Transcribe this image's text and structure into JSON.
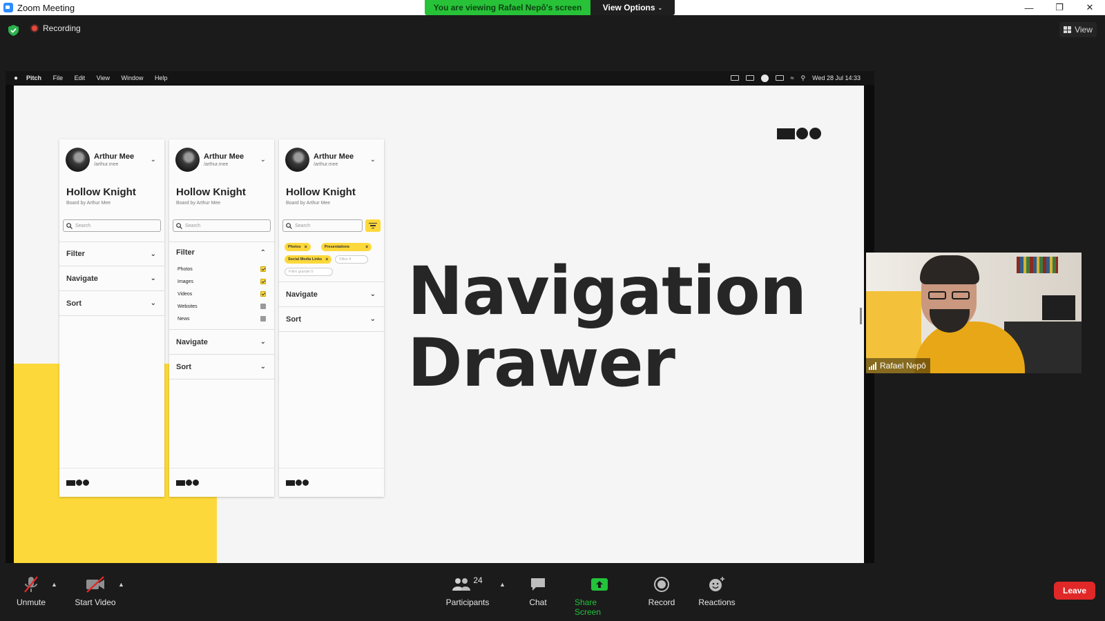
{
  "window": {
    "title": "Zoom Meeting"
  },
  "banner": {
    "viewing_text": "You are viewing Rafael Nepô's screen",
    "view_options_label": "View Options"
  },
  "meeting": {
    "recording_label": "Recording",
    "view_label": "View"
  },
  "mac_menu": {
    "items": [
      "Pitch",
      "File",
      "Edit",
      "View",
      "Window",
      "Help"
    ],
    "clock": "Wed 28 Jul  14:33"
  },
  "slide": {
    "title_line1": "Navigation",
    "title_line2": "Drawer",
    "panels": [
      {
        "user_name": "Arthur Mee",
        "user_handle": "/arthur.mee",
        "board_title": "Hollow Knight",
        "board_sub": "Board by Arthur Mee",
        "search_placeholder": "Search",
        "sections": [
          "Filter",
          "Navigate",
          "Sort"
        ]
      },
      {
        "user_name": "Arthur Mee",
        "user_handle": "/arthur.mee",
        "board_title": "Hollow Knight",
        "board_sub": "Board by Arthur Mee",
        "search_placeholder": "Search",
        "filter_label": "Filter",
        "filter_options": [
          {
            "label": "Photos",
            "checked": true
          },
          {
            "label": "Images",
            "checked": true
          },
          {
            "label": "Videos",
            "checked": true
          },
          {
            "label": "Websites",
            "checked": false
          },
          {
            "label": "News",
            "checked": false
          }
        ],
        "sections": [
          "Navigate",
          "Sort"
        ]
      },
      {
        "user_name": "Arthur Mee",
        "user_handle": "/arthur.mee",
        "board_title": "Hollow Knight",
        "board_sub": "Board by Arthur Mee",
        "search_placeholder": "Search",
        "chips": [
          "Photos",
          "Presentations",
          "Social Media Links"
        ],
        "empty_chips": [
          "Filtro 4",
          "Filtro grande 5"
        ],
        "sections": [
          "Navigate",
          "Sort"
        ]
      }
    ]
  },
  "participant": {
    "name": "Rafael Nepô"
  },
  "toolbar": {
    "unmute": "Unmute",
    "start_video": "Start Video",
    "participants": "Participants",
    "participants_count": "24",
    "chat": "Chat",
    "share_screen": "Share Screen",
    "record": "Record",
    "reactions": "Reactions",
    "leave": "Leave"
  },
  "colors": {
    "accent_yellow": "#fdd83a",
    "share_green": "#22c33b",
    "leave_red": "#e02828",
    "banner_green": "#27c238"
  }
}
